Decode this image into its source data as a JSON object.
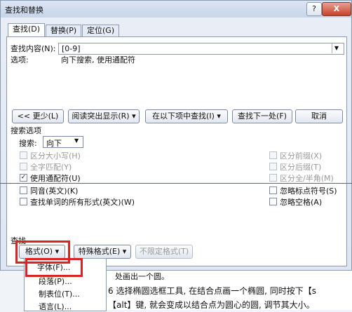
{
  "window": {
    "title": "查找和替换",
    "help_label": "?",
    "close_label": "X"
  },
  "tabs": [
    {
      "label": "查找(D)"
    },
    {
      "label": "替换(P)"
    },
    {
      "label": "定位(G)"
    }
  ],
  "find": {
    "label": "查找内容(N):",
    "value": "[0-9]",
    "options_label": "选项:",
    "options_value": "向下搜索, 使用通配符"
  },
  "buttons": {
    "less": "<< 更少(L)",
    "highlight": "阅读突出显示(R)",
    "find_in": "在以下项中查找(I)",
    "find_next": "查找下一处(F)",
    "cancel": "取消"
  },
  "search_options": {
    "heading": "搜索选项",
    "search_label": "搜索:",
    "search_value": "向下",
    "left": [
      {
        "label": "区分大小写(H)",
        "checked": false,
        "disabled": true
      },
      {
        "label": "全字匹配(Y)",
        "checked": false,
        "disabled": true
      },
      {
        "label": "使用通配符(U)",
        "checked": true,
        "disabled": false
      },
      {
        "label": "同音(英文)(K)",
        "checked": false,
        "disabled": false
      },
      {
        "label": "查找单词的所有形式(英文)(W)",
        "checked": false,
        "disabled": false
      }
    ],
    "right": [
      {
        "label": "区分前缀(X)",
        "checked": false,
        "disabled": true
      },
      {
        "label": "区分后缀(T)",
        "checked": false,
        "disabled": true
      },
      {
        "label": "区分全/半角(M)",
        "checked": false,
        "disabled": true
      },
      {
        "label": "忽略标点符号(S)",
        "checked": false,
        "disabled": false
      },
      {
        "label": "忽略空格(A)",
        "checked": false,
        "disabled": false
      }
    ]
  },
  "find_section": {
    "heading": "查找",
    "format": "格式(O)",
    "special": "特殊格式(E)",
    "no_format": "不限定格式(T)"
  },
  "format_menu": [
    {
      "label": "字体(F)..."
    },
    {
      "label": "段落(P)..."
    },
    {
      "label": "制表位(T)..."
    },
    {
      "label": "语言(L)..."
    }
  ],
  "background_doc": {
    "line1": "处画出一个圆。",
    "line2": "6 选择椭圆选框工具, 在结合点画一个椭圆, 同时按下【s",
    "line3": "【alt】键, 就会变成以结合点为圆心的圆, 调节其大小。"
  }
}
